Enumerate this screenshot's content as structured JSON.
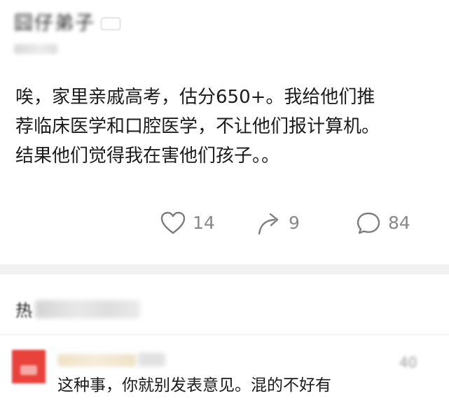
{
  "post": {
    "author_name": "囧仔弟子",
    "body_lines": [
      "唉，家里亲戚高考，估分650+。我给他们推",
      "荐临床医学和口腔医学，不让他们报计算机。",
      "结果他们觉得我在害他们孩子。。"
    ],
    "actions": {
      "like_icon": "heart-outline-icon",
      "like_count": "14",
      "share_icon": "share-arrow-icon",
      "share_count": "9",
      "comment_icon": "comment-bubble-icon",
      "comment_count": "84"
    }
  },
  "comments": {
    "title_visible": "热",
    "items": [
      {
        "avatar_icon": "avatar-red",
        "text": "这种事，你就别发表意见。混的不好有",
        "like_count": "40"
      }
    ]
  },
  "colors": {
    "background": "#ffffff",
    "separator": "#f1f1f1",
    "secondary_text": "#888888",
    "avatar": "#e9423b"
  }
}
